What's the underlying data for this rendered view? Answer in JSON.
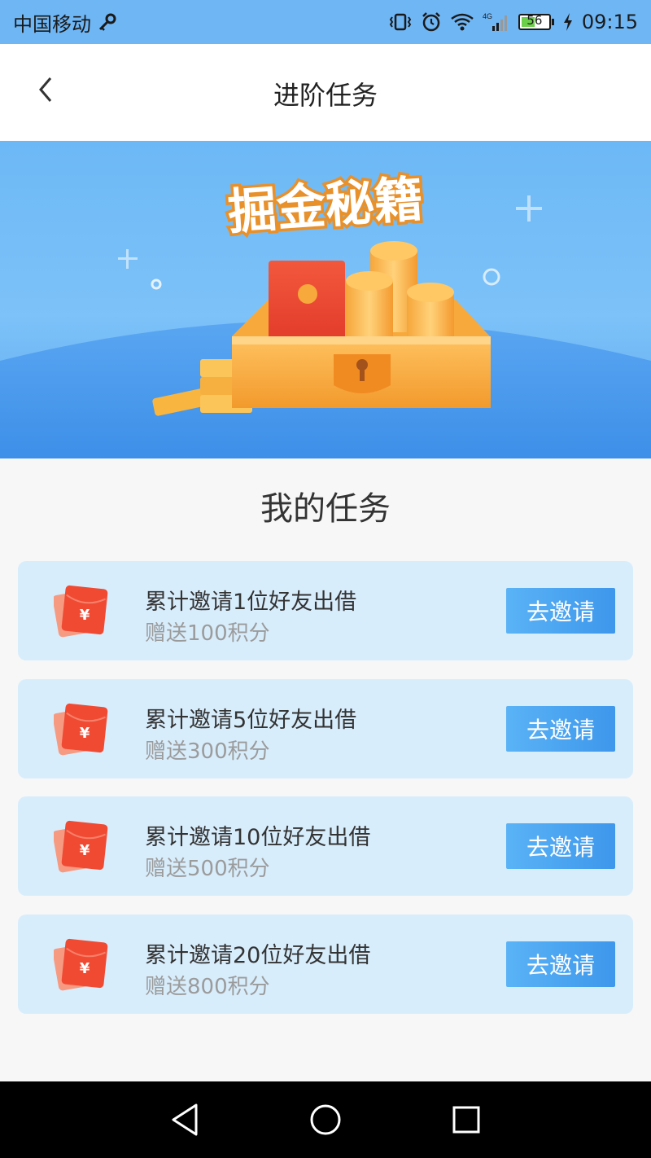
{
  "status_bar": {
    "carrier": "中国移动",
    "network": "4G",
    "battery": "56",
    "battery_level": 0.56,
    "time": "09:15",
    "icons": [
      "key-icon",
      "vibrate-icon",
      "alarm-icon",
      "wifi-icon",
      "signal-icon",
      "battery-icon",
      "charging-icon"
    ]
  },
  "header": {
    "title": "进阶任务",
    "back_icon": "chevron-left-icon"
  },
  "banner": {
    "title": "掘金秘籍"
  },
  "section": {
    "title": "我的任务"
  },
  "tasks": [
    {
      "title": "累计邀请1位好友出借",
      "reward": "赠送100积分",
      "button": "去邀请",
      "icon": "red-envelope-icon"
    },
    {
      "title": "累计邀请5位好友出借",
      "reward": "赠送300积分",
      "button": "去邀请",
      "icon": "red-envelope-icon"
    },
    {
      "title": "累计邀请10位好友出借",
      "reward": "赠送500积分",
      "button": "去邀请",
      "icon": "red-envelope-icon"
    },
    {
      "title": "累计邀请20位好友出借",
      "reward": "赠送800积分",
      "button": "去邀请",
      "icon": "red-envelope-icon"
    }
  ],
  "navbar": {
    "icons": [
      "back-triangle-icon",
      "home-circle-icon",
      "recents-square-icon"
    ]
  },
  "colors": {
    "status_bar": "#6fb6f5",
    "banner": "#6cb8f6",
    "card": "#d8edfc",
    "button": "#3e97eb",
    "envelope": "#f0553d"
  }
}
